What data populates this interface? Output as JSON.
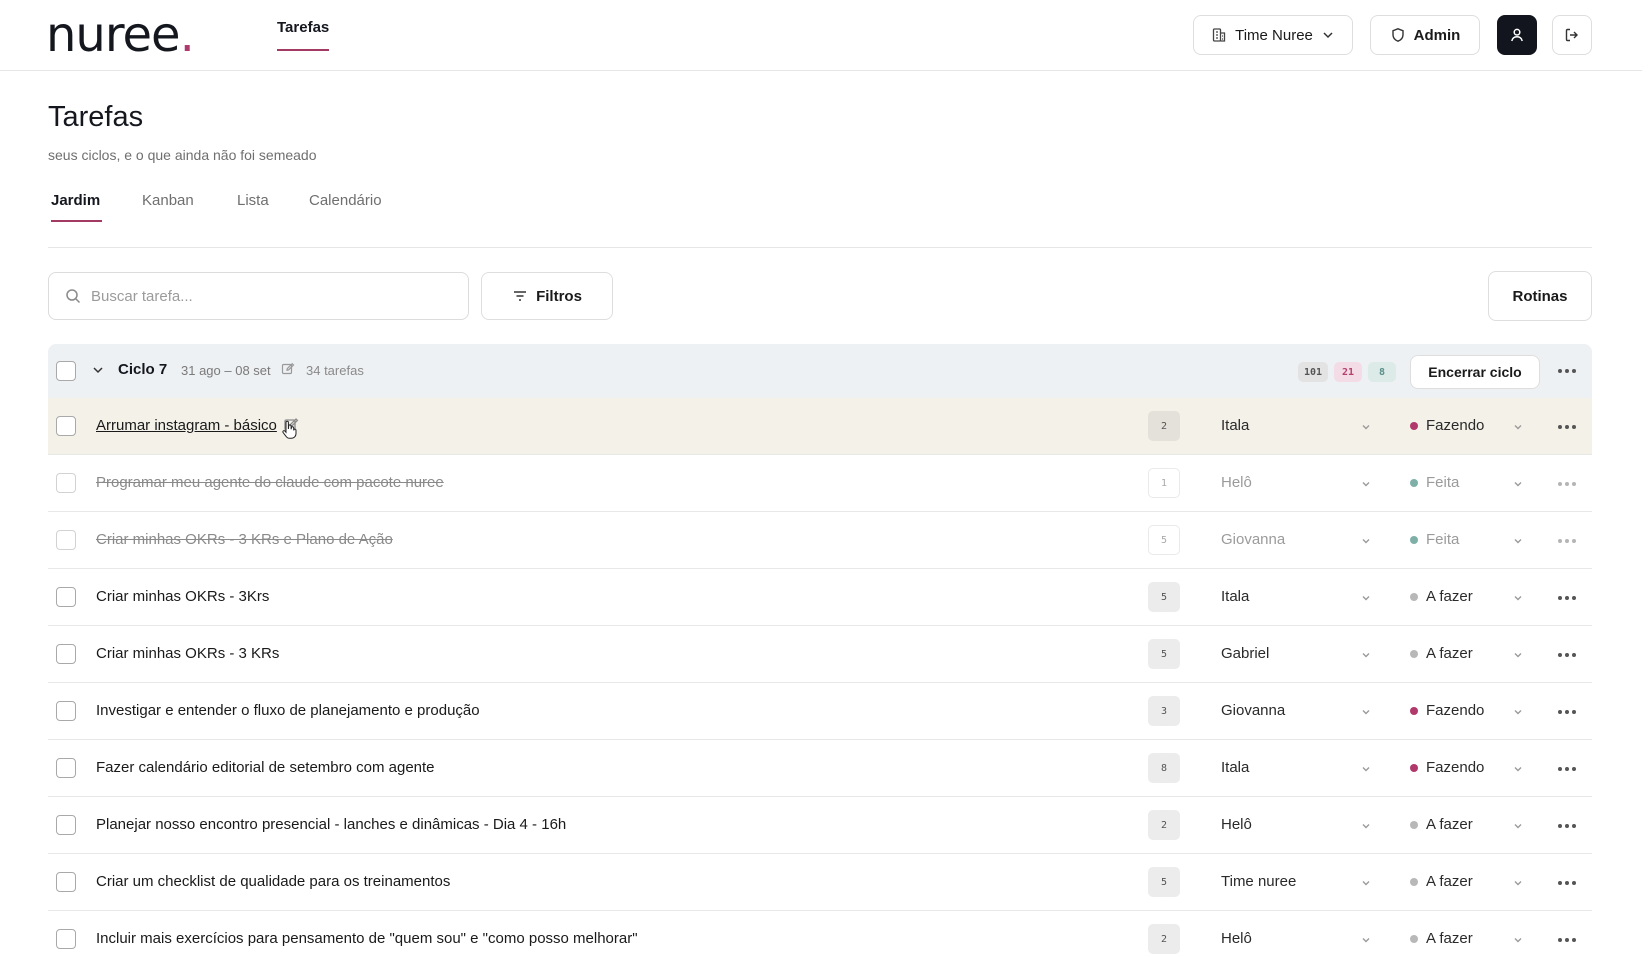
{
  "app": {
    "logo": "nuree",
    "logo_dot": ".",
    "nav_tab": "Tarefas",
    "team_selector": "Time Nuree",
    "admin_label": "Admin"
  },
  "header": {
    "title": "Tarefas",
    "subtitle": "seus ciclos, e o que ainda não foi semeado",
    "view_tabs": [
      "Jardim",
      "Kanban",
      "Lista",
      "Calendário"
    ],
    "active_view": "Jardim"
  },
  "toolbar": {
    "search_placeholder": "Buscar tarefa...",
    "filters_label": "Filtros",
    "routines_label": "Rotinas"
  },
  "cycle": {
    "name": "Ciclo 7",
    "dates": "31 ago – 08 set",
    "task_count": "34 tarefas",
    "counters": [
      "101",
      "21",
      "8"
    ],
    "end_button": "Encerrar ciclo"
  },
  "status_colors": {
    "Fazendo": "#b0386a",
    "Feita": "#7fb0a8",
    "A fazer": "#b8b8b8"
  },
  "tasks": [
    {
      "title": "Arrumar instagram - básico",
      "points": "2",
      "assignee": "Itala",
      "status": "Fazendo",
      "done": false
    },
    {
      "title": "Programar meu agente do claude com pacote nuree",
      "points": "1",
      "assignee": "Helô",
      "status": "Feita",
      "done": true
    },
    {
      "title": "Criar minhas OKRs - 3 KRs e Plano de Ação",
      "points": "5",
      "assignee": "Giovanna",
      "status": "Feita",
      "done": true
    },
    {
      "title": "Criar minhas OKRs - 3Krs",
      "points": "5",
      "assignee": "Itala",
      "status": "A fazer",
      "done": false
    },
    {
      "title": "Criar minhas OKRs - 3 KRs",
      "points": "5",
      "assignee": "Gabriel",
      "status": "A fazer",
      "done": false
    },
    {
      "title": "Investigar e entender o fluxo de planejamento e produção",
      "points": "3",
      "assignee": "Giovanna",
      "status": "Fazendo",
      "done": false
    },
    {
      "title": "Fazer calendário editorial de setembro com agente",
      "points": "8",
      "assignee": "Itala",
      "status": "Fazendo",
      "done": false
    },
    {
      "title": "Planejar nosso encontro presencial - lanches e dinâmicas - Dia 4 - 16h",
      "points": "2",
      "assignee": "Helô",
      "status": "A fazer",
      "done": false
    },
    {
      "title": "Criar um checklist de qualidade para os treinamentos",
      "points": "5",
      "assignee": "Time nuree",
      "status": "A fazer",
      "done": false
    },
    {
      "title": "Incluir mais exercícios para pensamento de \"quem sou\" e \"como posso melhorar\"",
      "points": "2",
      "assignee": "Helô",
      "status": "A fazer",
      "done": false
    }
  ]
}
